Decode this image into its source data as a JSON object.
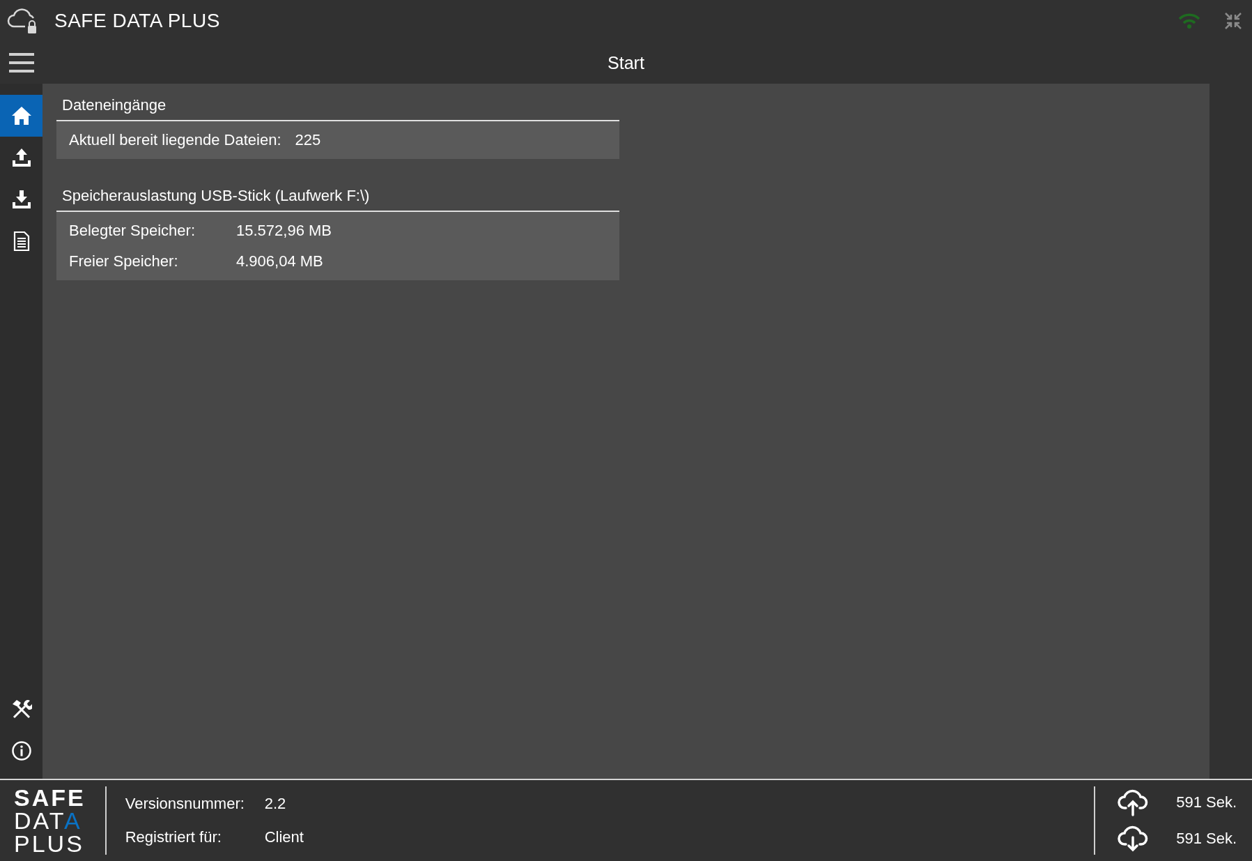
{
  "window": {
    "title": "SAFE DATA PLUS"
  },
  "header": {
    "title": "Start"
  },
  "sidebar": {
    "items": [
      {
        "kind": "home",
        "selected": true
      },
      {
        "kind": "upload",
        "selected": false
      },
      {
        "kind": "download",
        "selected": false
      },
      {
        "kind": "document",
        "selected": false
      }
    ],
    "bottom_items": [
      {
        "kind": "tools",
        "selected": false
      },
      {
        "kind": "info",
        "selected": false
      }
    ]
  },
  "sections": [
    {
      "title": "Dateneingänge",
      "rows": [
        {
          "label": "Aktuell bereit liegende Dateien:",
          "value": "225"
        }
      ]
    },
    {
      "title": "Speicherauslastung USB-Stick (Laufwerk F:\\)",
      "rows": [
        {
          "label": "Belegter Speicher:",
          "value": "15.572,96 MB"
        },
        {
          "label": "Freier Speicher:",
          "value": "4.906,04 MB"
        }
      ]
    }
  ],
  "footer": {
    "logo": [
      "SAFE",
      "DATA",
      "PLUS"
    ],
    "info": [
      {
        "label": "Versionsnummer:",
        "value": "2.2"
      },
      {
        "label": "Registriert für:",
        "value": "Client"
      }
    ],
    "timers": [
      {
        "kind": "upload",
        "value": "591 Sek."
      },
      {
        "kind": "download",
        "value": "591 Sek."
      }
    ]
  }
}
